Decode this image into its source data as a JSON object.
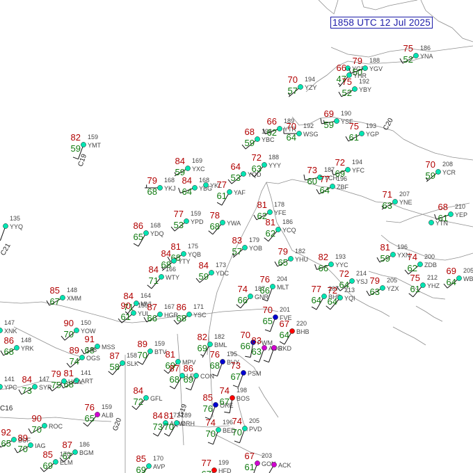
{
  "timestamp": "1858 UTC 12 Jul 2025",
  "colors": {
    "temperature": "#b10000",
    "dewpoint": "#0f7a0f",
    "station_label": "#444444",
    "title_box": "#1a1aa8",
    "boundaries": "#8e8e8e",
    "wind_barb": "#111111",
    "sky_clear": "#00e5b2",
    "sky_high": "#1a8cff",
    "sky_mid": "#0000d0",
    "sky_low": "#ff0000",
    "sky_weather": "#d000d0"
  },
  "stations": [
    {
      "id": "YYQ",
      "temp": "",
      "dew": "",
      "press": "135",
      "sky": "clear"
    },
    {
      "id": "YMT",
      "temp": "82",
      "dew": "59",
      "press": "159",
      "sky": "clear"
    },
    {
      "id": "YXC",
      "temp": "84",
      "dew": "59",
      "press": "169",
      "sky": "clear"
    },
    {
      "id": "YKJ",
      "temp": "79",
      "dew": "68",
      "press": "168",
      "sky": "clear"
    },
    {
      "id": "YBG",
      "temp": "84",
      "dew": "64",
      "press": "168",
      "sky": "clear"
    },
    {
      "id": "YKL",
      "temp": "",
      "dew": "",
      "press": "",
      "sky": "clear"
    },
    {
      "id": "YAF",
      "temp": "77",
      "dew": "61",
      "press": "",
      "sky": "clear"
    },
    {
      "id": "YQD",
      "temp": "64",
      "dew": "53",
      "press": "",
      "sky": "clear"
    },
    {
      "id": "YYY",
      "temp": "72",
      "dew": "63",
      "press": "188",
      "sky": "clear"
    },
    {
      "id": "YBC",
      "temp": "68",
      "dew": "59",
      "press": "196",
      "sky": "clear"
    },
    {
      "id": "YTR",
      "temp": "66",
      "dew": "62",
      "press": "189",
      "sky": "clear"
    },
    {
      "id": "WSG",
      "temp": "70",
      "dew": "64",
      "press": "192",
      "sky": "clear"
    },
    {
      "id": "YSF",
      "temp": "69",
      "dew": "59",
      "press": "190",
      "sky": "clear"
    },
    {
      "id": "YGP",
      "temp": "75",
      "dew": "61",
      "press": "193",
      "sky": "clear"
    },
    {
      "id": "YZY",
      "temp": "70",
      "dew": "57",
      "press": "194",
      "sky": "clear"
    },
    {
      "id": "YGR",
      "temp": "",
      "dew": "",
      "press": "",
      "sky": "clear"
    },
    {
      "id": "YGV",
      "temp": "79",
      "dew": "50",
      "press": "188",
      "sky": "clear"
    },
    {
      "id": "YNA",
      "temp": "75",
      "dew": "52",
      "press": "186",
      "sky": "clear"
    },
    {
      "id": "YHR",
      "temp": "66",
      "dew": "47",
      "press": "",
      "sky": "clear"
    },
    {
      "id": "YBY",
      "temp": "75",
      "dew": "52",
      "press": "192",
      "sky": "clear"
    },
    {
      "id": "YCH",
      "temp": "73",
      "dew": "60",
      "press": "187",
      "sky": "clear"
    },
    {
      "id": "YFC",
      "temp": "72",
      "dew": "69",
      "press": "194",
      "sky": "clear"
    },
    {
      "id": "ZBF",
      "temp": "77",
      "dew": "64",
      "press": "196",
      "sky": "clear"
    },
    {
      "id": "YCR",
      "temp": "70",
      "dew": "59",
      "press": "208",
      "sky": "clear"
    },
    {
      "id": "YNE",
      "temp": "71",
      "dew": "63",
      "press": "207",
      "sky": "clear"
    },
    {
      "id": "YEP",
      "temp": "68",
      "dew": "61",
      "press": "210",
      "sky": "clear"
    },
    {
      "id": "YPD",
      "temp": "77",
      "dew": "53",
      "press": "159",
      "sky": "clear"
    },
    {
      "id": "YWA",
      "temp": "78",
      "dew": "68",
      "press": "",
      "sky": "clear"
    },
    {
      "id": "YQB",
      "temp": "81",
      "dew": "68",
      "press": "175",
      "sky": "clear"
    },
    {
      "id": "YDQ",
      "temp": "86",
      "dew": "65",
      "press": "168",
      "sky": "clear"
    },
    {
      "id": "YTY",
      "temp": "84",
      "dew": "68",
      "press": "",
      "sky": "clear"
    },
    {
      "id": "WTY",
      "temp": "84",
      "dew": "71",
      "press": "166",
      "sky": "clear"
    },
    {
      "id": "YDC",
      "temp": "84",
      "dew": "59",
      "press": "173",
      "sky": "clear"
    },
    {
      "id": "YFE",
      "temp": "81",
      "dew": "62",
      "press": "178",
      "sky": "clear"
    },
    {
      "id": "YCQ",
      "temp": "81",
      "dew": "62",
      "press": "186",
      "sky": "clear"
    },
    {
      "id": "YOB",
      "temp": "83",
      "dew": "57",
      "press": "179",
      "sky": "clear"
    },
    {
      "id": "YHU",
      "temp": "79",
      "dew": "65",
      "press": "182",
      "sky": "clear"
    },
    {
      "id": "YYC",
      "temp": "82",
      "dew": "66",
      "press": "193",
      "sky": "clear"
    },
    {
      "id": "YXN",
      "temp": "81",
      "dew": "59",
      "press": "196",
      "sky": "clear"
    },
    {
      "id": "ZDB",
      "temp": "74",
      "dew": "62",
      "press": "200",
      "sky": "clear"
    },
    {
      "id": "YHZ",
      "temp": "75",
      "dew": "61",
      "press": "212",
      "sky": "clear"
    },
    {
      "id": "WBY",
      "temp": "69",
      "dew": "64",
      "press": "205",
      "sky": "clear"
    },
    {
      "id": "YZX",
      "temp": "79",
      "dew": "63",
      "press": "205",
      "sky": "clear"
    },
    {
      "id": "YSJ",
      "temp": "72",
      "dew": "64",
      "press": "214",
      "sky": "clear"
    },
    {
      "id": "XMM",
      "temp": "85",
      "dew": "67",
      "press": "148",
      "sky": "clear"
    },
    {
      "id": "MVL",
      "temp": "84",
      "dew": "71",
      "press": "164",
      "sky": "clear"
    },
    {
      "id": "YUL",
      "temp": "90",
      "dew": "61",
      "press": "155",
      "sky": "clear"
    },
    {
      "id": "HGR",
      "temp": "87",
      "dew": "66",
      "press": "167",
      "sky": "clear"
    },
    {
      "id": "YSC",
      "temp": "86",
      "dew": "68",
      "press": "171",
      "sky": "clear"
    },
    {
      "id": "GNR",
      "temp": "74",
      "dew": "66",
      "press": "187",
      "sky": "clear"
    },
    {
      "id": "MLT",
      "temp": "76",
      "dew": "66",
      "press": "204",
      "sky": "clear"
    },
    {
      "id": "BHB",
      "temp": "77",
      "dew": "64",
      "press": "207",
      "sky": "clear"
    },
    {
      "id": "YQI",
      "temp": "72",
      "dew": "64",
      "press": "213",
      "sky": "clear"
    },
    {
      "id": "YTN",
      "temp": "",
      "dew": "",
      "press": "",
      "sky": "clear"
    },
    {
      "id": "XNK",
      "temp": "",
      "dew": "",
      "press": "147",
      "sky": "clear"
    },
    {
      "id": "YRK",
      "temp": "86",
      "dew": "68",
      "press": "148",
      "sky": "clear"
    },
    {
      "id": "YOW",
      "temp": "90",
      "dew": "70",
      "press": "150",
      "sky": "clear"
    },
    {
      "id": "MSS",
      "temp": "91",
      "dew": "68",
      "press": "",
      "sky": "clear"
    },
    {
      "id": "OGS",
      "temp": "89",
      "dew": "74",
      "press": "148",
      "sky": "clear"
    },
    {
      "id": "SLK",
      "temp": "87",
      "dew": "58",
      "press": "158",
      "sky": "clear"
    },
    {
      "id": "BTV",
      "temp": "89",
      "dew": "70",
      "press": "159",
      "sky": "clear"
    },
    {
      "id": "MPV",
      "temp": "81",
      "dew": "69",
      "press": "",
      "sky": "clear"
    },
    {
      "id": "LEB",
      "temp": "87",
      "dew": "68",
      "press": "",
      "sky": "clear"
    },
    {
      "id": "CON",
      "temp": "86",
      "dew": "69",
      "press": "",
      "sky": "clear"
    },
    {
      "id": "BML",
      "temp": "82",
      "dew": "69",
      "press": "182",
      "sky": "clear"
    },
    {
      "id": "PWM",
      "temp": "70",
      "dew": "66",
      "press": "",
      "sky": "mid"
    },
    {
      "id": "AUG",
      "temp": "83",
      "dew": "63",
      "press": "",
      "sky": "weather"
    },
    {
      "id": "RKD",
      "temp": "",
      "dew": "",
      "press": "",
      "sky": "weather"
    },
    {
      "id": "BHB2",
      "temp": "67",
      "dew": "64",
      "press": "220",
      "sky": "low"
    },
    {
      "id": "FVE",
      "temp": "70",
      "dew": "65",
      "press": "201",
      "sky": "mid"
    },
    {
      "id": "ART",
      "temp": "81",
      "dew": "68",
      "press": "141",
      "sky": "clear"
    },
    {
      "id": "SYR",
      "temp": "84",
      "dew": "73",
      "press": "147",
      "sky": "clear"
    },
    {
      "id": "UCA",
      "temp": "79",
      "dew": "75",
      "press": "",
      "sky": "clear"
    },
    {
      "id": "YPC",
      "temp": "",
      "dew": "",
      "press": "141",
      "sky": "clear"
    },
    {
      "id": "ALB",
      "temp": "76",
      "dew": "65",
      "press": "159",
      "sky": "weather"
    },
    {
      "id": "AQW",
      "temp": "84",
      "dew": "73",
      "press": "172",
      "sky": "clear"
    },
    {
      "id": "GFL",
      "temp": "84",
      "dew": "72",
      "press": "",
      "sky": "clear"
    },
    {
      "id": "ORE",
      "temp": "85",
      "dew": "76",
      "press": "",
      "sky": "mid"
    },
    {
      "id": "BOS",
      "temp": "74",
      "dew": "67",
      "press": "198",
      "sky": "low"
    },
    {
      "id": "BVY",
      "temp": "76",
      "dew": "68",
      "press": "195",
      "sky": "mid"
    },
    {
      "id": "PSM",
      "temp": "73",
      "dew": "67",
      "press": "",
      "sky": "mid"
    },
    {
      "id": "ORH",
      "temp": "81",
      "dew": "70",
      "press": "189",
      "sky": "clear"
    },
    {
      "id": "BED",
      "temp": "74",
      "dew": "70",
      "press": "196",
      "sky": "clear"
    },
    {
      "id": "PVD",
      "temp": "74",
      "dew": "70",
      "press": "205",
      "sky": "clear"
    },
    {
      "id": "BUF",
      "temp": "92",
      "dew": "65",
      "press": "",
      "sky": "clear"
    },
    {
      "id": "ROC",
      "temp": "90",
      "dew": "70",
      "press": "",
      "sky": "clear"
    },
    {
      "id": "IAG",
      "temp": "89",
      "dew": "70",
      "press": "",
      "sky": "clear"
    },
    {
      "id": "BGM",
      "temp": "87",
      "dew": "67",
      "press": "186",
      "sky": "clear"
    },
    {
      "id": "ELM",
      "temp": "85",
      "dew": "69",
      "press": "170",
      "sky": "clear"
    },
    {
      "id": "AVP",
      "temp": "85",
      "dew": "69",
      "press": "170",
      "sky": "clear"
    },
    {
      "id": "HFD",
      "temp": "77",
      "dew": "67",
      "press": "199",
      "sky": "low"
    },
    {
      "id": "GON",
      "temp": "67",
      "dew": "61",
      "press": "203",
      "sky": "weather"
    },
    {
      "id": "ACK",
      "temp": "",
      "dew": "",
      "press": "",
      "sky": "weather"
    }
  ],
  "fronts": [
    {
      "label": "C19"
    },
    {
      "label": "C21"
    },
    {
      "label": "C20"
    },
    {
      "label": "G20"
    },
    {
      "label": "G19"
    },
    {
      "label": "C16"
    }
  ]
}
